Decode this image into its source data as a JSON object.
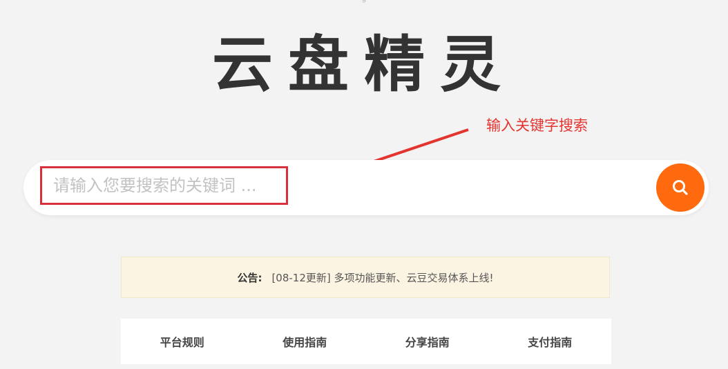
{
  "top_glyph": "g",
  "logo": {
    "text": "云盘精灵"
  },
  "annotation": {
    "text": "输入关键字搜索"
  },
  "search": {
    "placeholder": "请输入您要搜索的关键词 ..."
  },
  "notice": {
    "label": "公告:",
    "text": "[08-12更新] 多项功能更新、云豆交易体系上线!"
  },
  "nav": {
    "items": [
      {
        "label": "平台规则"
      },
      {
        "label": "使用指南"
      },
      {
        "label": "分享指南"
      },
      {
        "label": "支付指南"
      }
    ]
  },
  "colors": {
    "accent": "#ff6a0f",
    "annotation": "#e3342f",
    "notice_bg": "#fcf4e3"
  },
  "icons": {
    "search_button": "search-icon",
    "annotation_arrow": "arrow-icon"
  }
}
